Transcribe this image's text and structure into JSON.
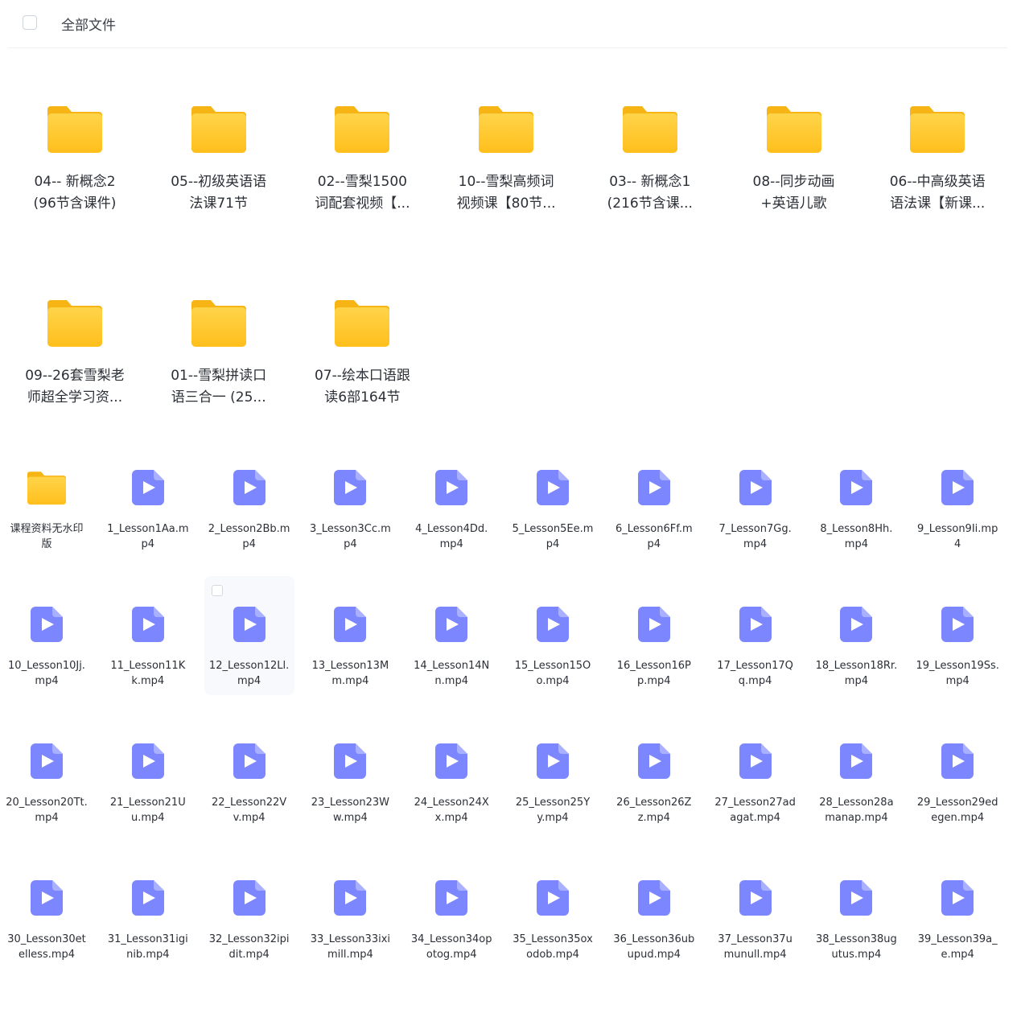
{
  "header": {
    "title": "全部文件"
  },
  "colors": {
    "folder_top": "#ffd44a",
    "folder_bottom": "#ffbf1c",
    "video": "#7b86ff"
  },
  "big_folders": [
    {
      "line1": "04-- 新概念2",
      "line2": "(96节含课件)"
    },
    {
      "line1": "05--初级英语语",
      "line2": "法课71节"
    },
    {
      "line1": "02--雪梨1500",
      "line2": "词配套视频【..."
    },
    {
      "line1": "10--雪梨高频词",
      "line2": "视频课【80节..."
    },
    {
      "line1": "03-- 新概念1",
      "line2": "(216节含课..."
    },
    {
      "line1": "08--同步动画",
      "line2": "+英语儿歌"
    },
    {
      "line1": "06--中高级英语",
      "line2": "语法课【新课..."
    },
    {
      "line1": "09--26套雪梨老",
      "line2": "师超全学习资..."
    },
    {
      "line1": "01--雪梨拼读口",
      "line2": "语三合一 (25..."
    },
    {
      "line1": "07--绘本口语跟",
      "line2": "读6部164节"
    }
  ],
  "small_items": [
    {
      "type": "folder",
      "line1": "课程资料无水印",
      "line2": "版"
    },
    {
      "type": "video",
      "line1": "1_Lesson1Aa.m",
      "line2": "p4"
    },
    {
      "type": "video",
      "line1": "2_Lesson2Bb.m",
      "line2": "p4"
    },
    {
      "type": "video",
      "line1": "3_Lesson3Cc.m",
      "line2": "p4"
    },
    {
      "type": "video",
      "line1": "4_Lesson4Dd.",
      "line2": "mp4"
    },
    {
      "type": "video",
      "line1": "5_Lesson5Ee.m",
      "line2": "p4"
    },
    {
      "type": "video",
      "line1": "6_Lesson6Ff.m",
      "line2": "p4"
    },
    {
      "type": "video",
      "line1": "7_Lesson7Gg.",
      "line2": "mp4"
    },
    {
      "type": "video",
      "line1": "8_Lesson8Hh.",
      "line2": "mp4"
    },
    {
      "type": "video",
      "line1": "9_Lesson9Ii.mp",
      "line2": "4"
    },
    {
      "type": "video",
      "line1": "10_Lesson10Jj.",
      "line2": "mp4"
    },
    {
      "type": "video",
      "line1": "11_Lesson11K",
      "line2": "k.mp4"
    },
    {
      "type": "video",
      "line1": "12_Lesson12Ll.",
      "line2": "mp4"
    },
    {
      "type": "video",
      "line1": "13_Lesson13M",
      "line2": "m.mp4"
    },
    {
      "type": "video",
      "line1": "14_Lesson14N",
      "line2": "n.mp4"
    },
    {
      "type": "video",
      "line1": "15_Lesson15O",
      "line2": "o.mp4"
    },
    {
      "type": "video",
      "line1": "16_Lesson16P",
      "line2": "p.mp4"
    },
    {
      "type": "video",
      "line1": "17_Lesson17Q",
      "line2": "q.mp4"
    },
    {
      "type": "video",
      "line1": "18_Lesson18Rr.",
      "line2": "mp4"
    },
    {
      "type": "video",
      "line1": "19_Lesson19Ss.",
      "line2": "mp4"
    },
    {
      "type": "video",
      "line1": "20_Lesson20Tt.",
      "line2": "mp4"
    },
    {
      "type": "video",
      "line1": "21_Lesson21U",
      "line2": "u.mp4"
    },
    {
      "type": "video",
      "line1": "22_Lesson22V",
      "line2": "v.mp4"
    },
    {
      "type": "video",
      "line1": "23_Lesson23W",
      "line2": "w.mp4"
    },
    {
      "type": "video",
      "line1": "24_Lesson24X",
      "line2": "x.mp4"
    },
    {
      "type": "video",
      "line1": "25_Lesson25Y",
      "line2": "y.mp4"
    },
    {
      "type": "video",
      "line1": "26_Lesson26Z",
      "line2": "z.mp4"
    },
    {
      "type": "video",
      "line1": "27_Lesson27ad",
      "line2": "agat.mp4"
    },
    {
      "type": "video",
      "line1": "28_Lesson28a",
      "line2": "manap.mp4"
    },
    {
      "type": "video",
      "line1": "29_Lesson29ed",
      "line2": "egen.mp4"
    },
    {
      "type": "video",
      "line1": "30_Lesson30et",
      "line2": "elless.mp4"
    },
    {
      "type": "video",
      "line1": "31_Lesson31igi",
      "line2": "nib.mp4"
    },
    {
      "type": "video",
      "line1": "32_Lesson32ipi",
      "line2": "dit.mp4"
    },
    {
      "type": "video",
      "line1": "33_Lesson33ixi",
      "line2": "mill.mp4"
    },
    {
      "type": "video",
      "line1": "34_Lesson34op",
      "line2": "otog.mp4"
    },
    {
      "type": "video",
      "line1": "35_Lesson35ox",
      "line2": "odob.mp4"
    },
    {
      "type": "video",
      "line1": "36_Lesson36ub",
      "line2": "upud.mp4"
    },
    {
      "type": "video",
      "line1": "37_Lesson37u",
      "line2": "munull.mp4"
    },
    {
      "type": "video",
      "line1": "38_Lesson38ug",
      "line2": "utus.mp4"
    },
    {
      "type": "video",
      "line1": "39_Lesson39a_",
      "line2": "e.mp4"
    }
  ]
}
